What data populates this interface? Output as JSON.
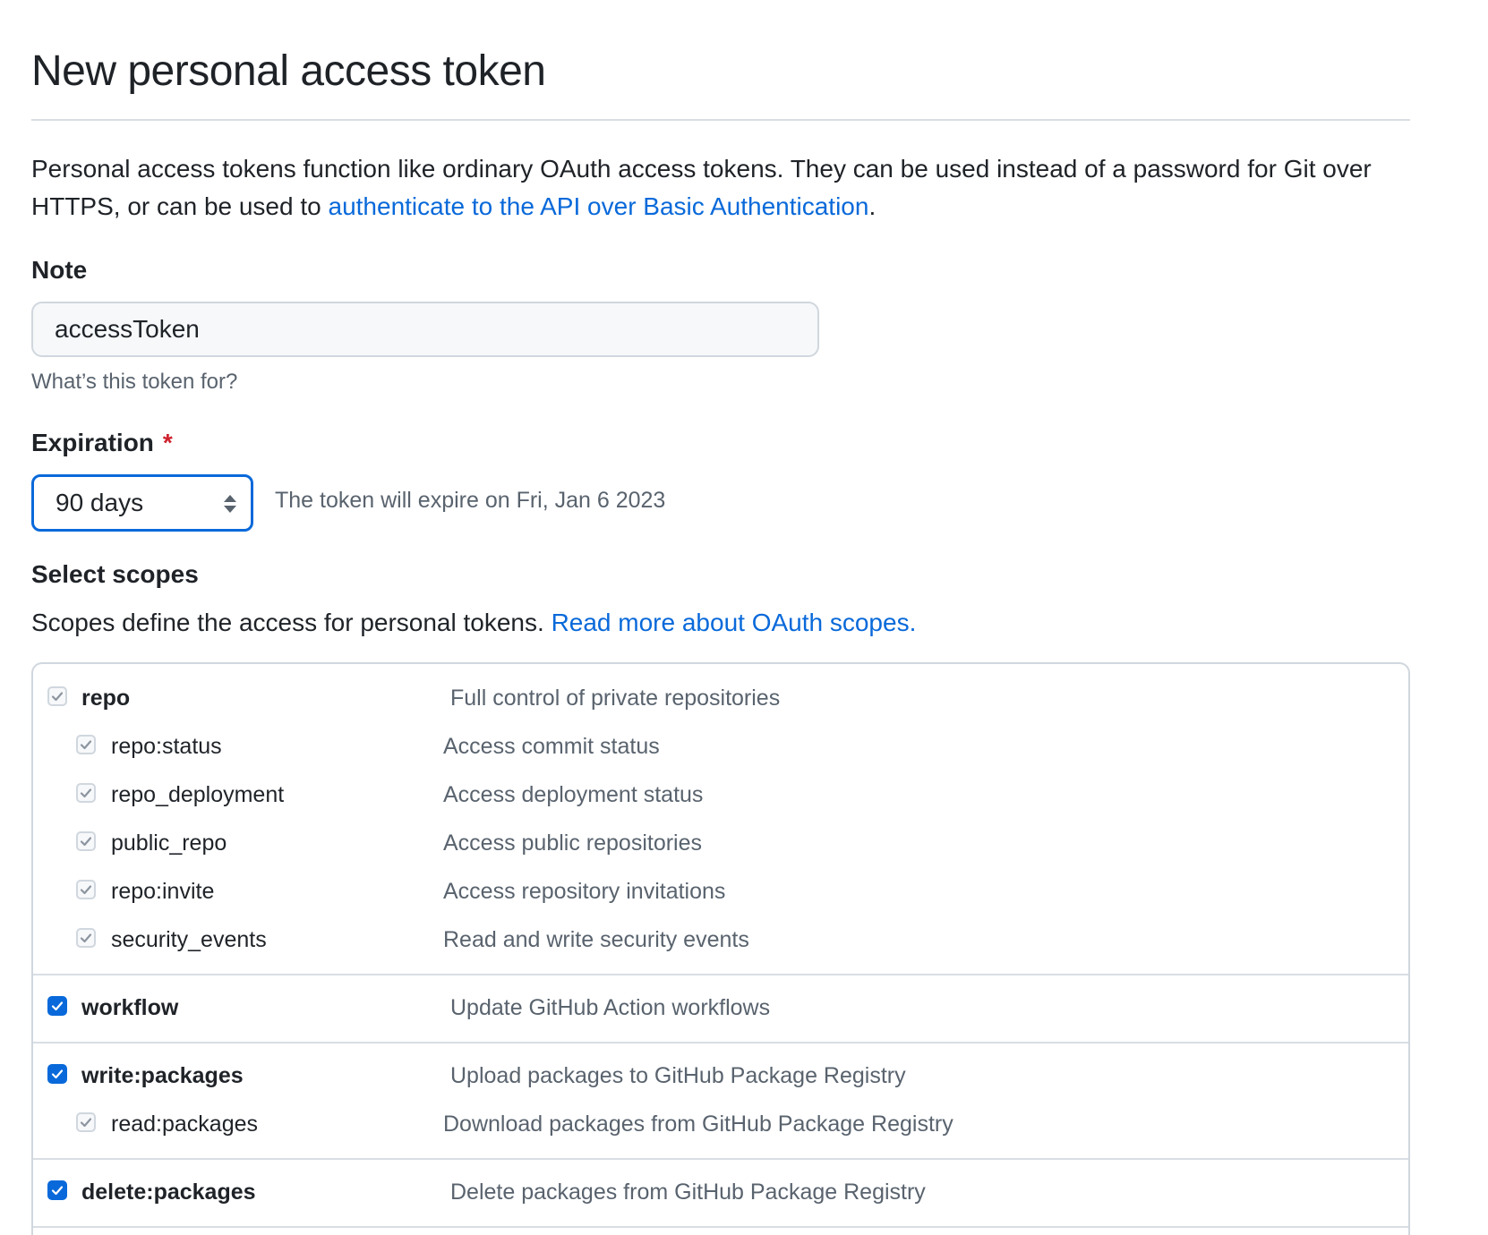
{
  "header": {
    "title": "New personal access token"
  },
  "intro": {
    "text_before": "Personal access tokens function like ordinary OAuth access tokens. They can be used instead of a password for Git over HTTPS, or can be used to ",
    "link": "authenticate to the API over Basic Authentication",
    "text_after": "."
  },
  "note": {
    "label": "Note",
    "value": "accessToken",
    "hint": "What’s this token for?"
  },
  "expiration": {
    "label": "Expiration",
    "required_mark": "*",
    "selected": "90 days",
    "expire_text": "The token will expire on Fri, Jan 6 2023"
  },
  "scopes": {
    "heading": "Select scopes",
    "description": "Scopes define the access for personal tokens. ",
    "link": "Read more about OAuth scopes.",
    "groups": [
      {
        "name": "repo",
        "desc": "Full control of private repositories",
        "checked": true,
        "children": [
          {
            "name": "repo:status",
            "desc": "Access commit status"
          },
          {
            "name": "repo_deployment",
            "desc": "Access deployment status"
          },
          {
            "name": "public_repo",
            "desc": "Access public repositories"
          },
          {
            "name": "repo:invite",
            "desc": "Access repository invitations"
          },
          {
            "name": "security_events",
            "desc": "Read and write security events"
          }
        ]
      },
      {
        "name": "workflow",
        "desc": "Update GitHub Action workflows",
        "checked": true,
        "children": []
      },
      {
        "name": "write:packages",
        "desc": "Upload packages to GitHub Package Registry",
        "checked": true,
        "children": [
          {
            "name": "read:packages",
            "desc": "Download packages from GitHub Package Registry"
          }
        ]
      },
      {
        "name": "delete:packages",
        "desc": "Delete packages from GitHub Package Registry",
        "checked": true,
        "children": []
      }
    ]
  },
  "colors": {
    "accent": "#0969da",
    "danger": "#cf222e",
    "muted": "#59636e",
    "border": "#d0d7de"
  }
}
